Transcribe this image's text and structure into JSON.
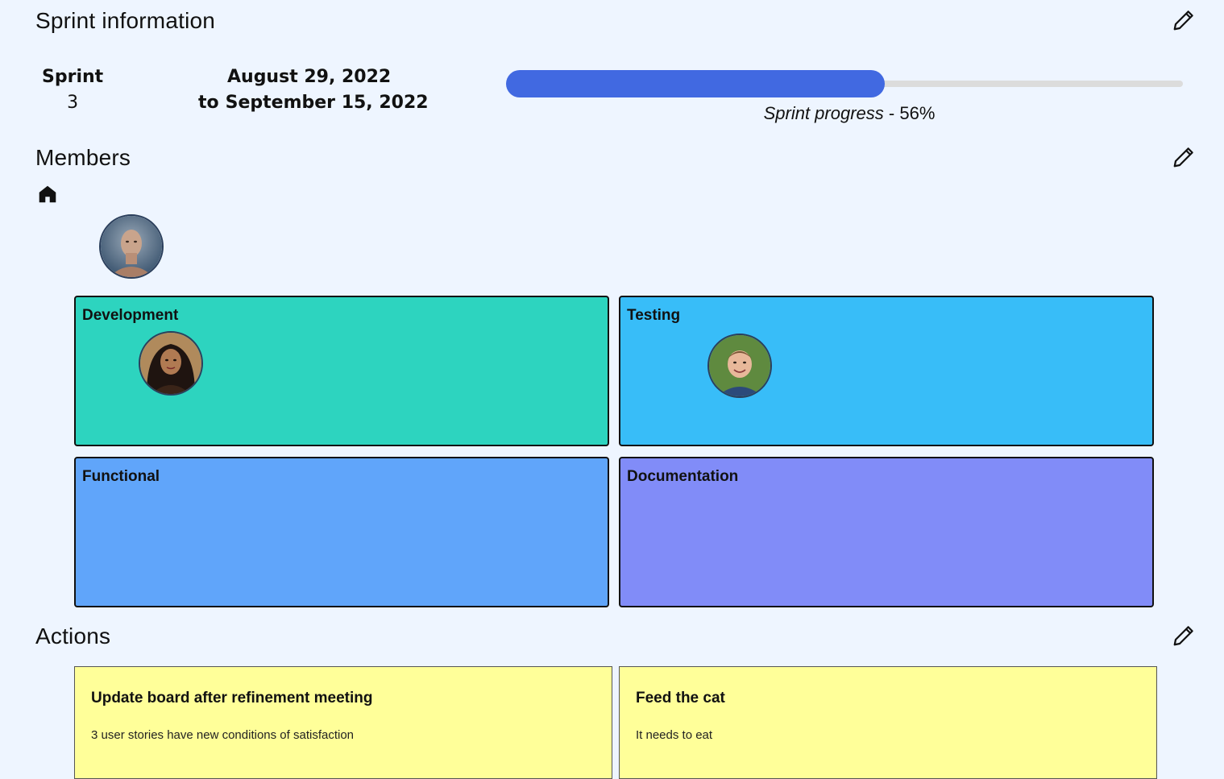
{
  "sprint_info": {
    "title": "Sprint information",
    "sprint_label": "Sprint",
    "sprint_number": "3",
    "start_date": "August 29, 2022",
    "to_label": "to",
    "end_date": "September 15, 2022",
    "progress_label": "Sprint progress",
    "progress_separator": "-",
    "progress_percent_text": "56%",
    "progress_value": 0.56,
    "progress_color": "#4169e1"
  },
  "members": {
    "title": "Members",
    "home_icon": "home-icon",
    "unassigned_avatar": "man-avatar",
    "teams": [
      {
        "name": "Development",
        "color": "#2dd4bf",
        "avatar": "girl-avatar"
      },
      {
        "name": "Testing",
        "color": "#38bdf8",
        "avatar": "boy-avatar"
      },
      {
        "name": "Functional",
        "color": "#60a5fa"
      },
      {
        "name": "Documentation",
        "color": "#818cf8"
      }
    ]
  },
  "actions": {
    "title": "Actions",
    "items": [
      {
        "title": "Update board after refinement meeting",
        "description": "3 user stories have new conditions of satisfaction"
      },
      {
        "title": "Feed the cat",
        "description": "It needs to eat"
      }
    ],
    "card_color": "#ffff99"
  },
  "edit_icon": "pencil-icon"
}
